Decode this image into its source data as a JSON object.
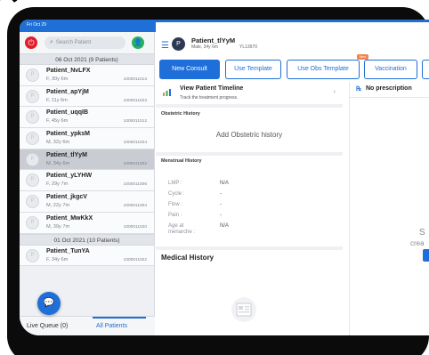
{
  "status_bar": {
    "time": "Fri Oct 29",
    "right": "58%"
  },
  "search": {
    "placeholder": "Search Patient"
  },
  "groups": [
    {
      "header": "06 Oct 2021 (9 Patients)"
    },
    {
      "header": "01 Oct 2021 (10 Patients)"
    }
  ],
  "patients": [
    {
      "name": "Patient_NvLFX",
      "age": "F, 30y 6m",
      "id": "1000011013"
    },
    {
      "name": "Patient_apYjM",
      "age": "F, 11y 6m",
      "id": "1000011023"
    },
    {
      "name": "Patient_uqqIB",
      "age": "F, 45y 6m",
      "id": "1000011012"
    },
    {
      "name": "Patient_ypksM",
      "age": "M, 32y 6m",
      "id": "1000011024"
    },
    {
      "name": "Patient_tlYyM",
      "age": "M, 34y 6m",
      "id": "1000011002"
    },
    {
      "name": "Patient_yLYHW",
      "age": "F, 29y 7m",
      "id": "1000011006"
    },
    {
      "name": "Patient_jkgcV",
      "age": "M, 22y 7m",
      "id": "1000011004"
    },
    {
      "name": "Patient_MwKkX",
      "age": "M, 39y 7m",
      "id": "1000011020"
    },
    {
      "name": "Patient_TunYA",
      "age": "F, 34y 6m",
      "id": "1000011022"
    }
  ],
  "tabs": {
    "live_queue": "Live Queue (0)",
    "all_patients": "All Patients"
  },
  "header": {
    "initial": "P",
    "name": "Patient_tlYyM",
    "info": "Male, 34y 6m",
    "id": "YL13970"
  },
  "actions": {
    "new_consult": "New Consult",
    "use_template": "Use Template",
    "use_obs_template": "Use Obs Template",
    "new_badge": "New",
    "vaccination": "Vaccination"
  },
  "timeline": {
    "title": "View Patient Timeline",
    "subtitle": "Track the treatment progress."
  },
  "obstetric": {
    "title": "Obstetric History",
    "add": "Add Obstetric history"
  },
  "menstrual": {
    "title": "Menstrual History",
    "rows": [
      {
        "label": "LMP :",
        "value": "N/A"
      },
      {
        "label": "Cycle :",
        "value": "-"
      },
      {
        "label": "Flow :",
        "value": "-"
      },
      {
        "label": "Pain :",
        "value": "-"
      },
      {
        "label": "Age at menarche :",
        "value": "N/A"
      }
    ]
  },
  "medical_history": {
    "title": "Medical History"
  },
  "prescription": {
    "rx": "℞",
    "title": "No prescription"
  },
  "side_partial": {
    "s": "S",
    "crea": "crea"
  },
  "colors": {
    "primary": "#1e6fd9",
    "logout": "#e21d2b",
    "add": "#27b35a",
    "badge": "#f1834a"
  }
}
